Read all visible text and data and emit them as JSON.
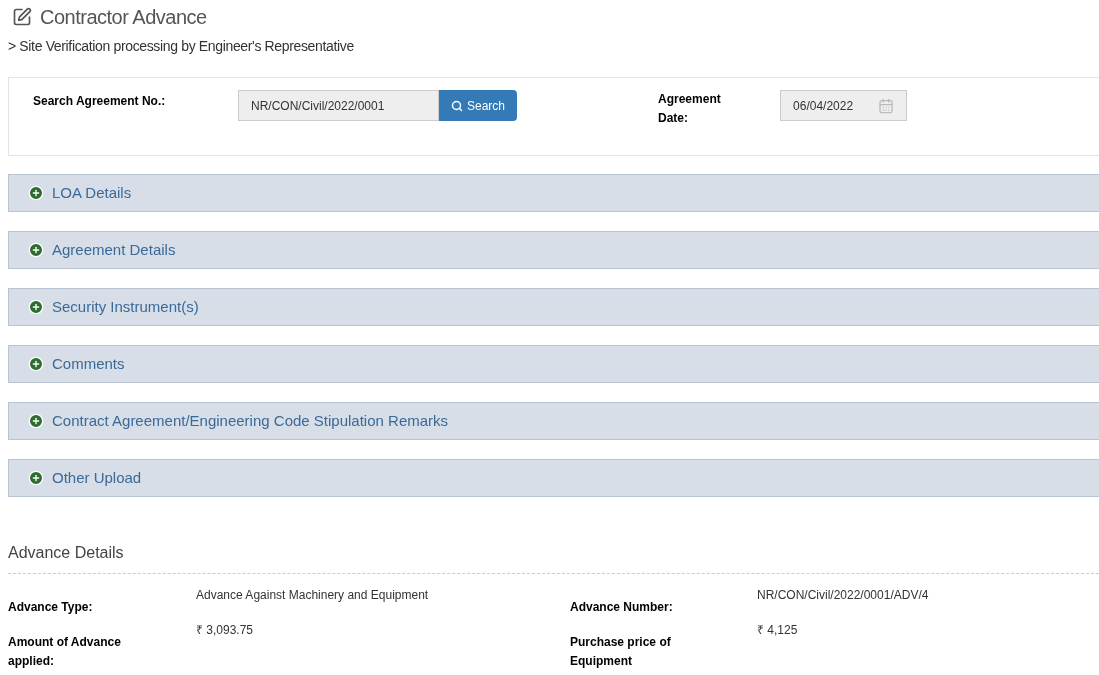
{
  "page": {
    "title": "Contractor Advance",
    "subtitle": "> Site Verification processing by Engineer's Representative"
  },
  "search": {
    "label": "Search Agreement No.:",
    "value": "NR/CON/Civil/2022/0001",
    "button": "Search",
    "date_label": "Agreement Date:",
    "date_value": "06/04/2022"
  },
  "sections": [
    {
      "title": "LOA Details",
      "expanded": false
    },
    {
      "title": "Agreement Details",
      "expanded": false
    },
    {
      "title": "Security Instrument(s)",
      "expanded": false
    },
    {
      "title": "Comments",
      "expanded": false
    },
    {
      "title": "Contract Agreement/Engineering Code Stipulation Remarks",
      "expanded": false
    },
    {
      "title": "Other Upload",
      "expanded": false
    }
  ],
  "advance_details": {
    "heading": "Advance Details",
    "fields": [
      {
        "label": "Advance Type:",
        "value": "Advance Against Machinery and Equipment"
      },
      {
        "label": "Advance Number:",
        "value": "NR/CON/Civil/2022/0001/ADV/4"
      },
      {
        "label": "Amount of Advance applied:",
        "value": "₹ 3,093.75"
      },
      {
        "label": "Purchase price of Equipment",
        "value": "₹ 4,125"
      }
    ]
  }
}
